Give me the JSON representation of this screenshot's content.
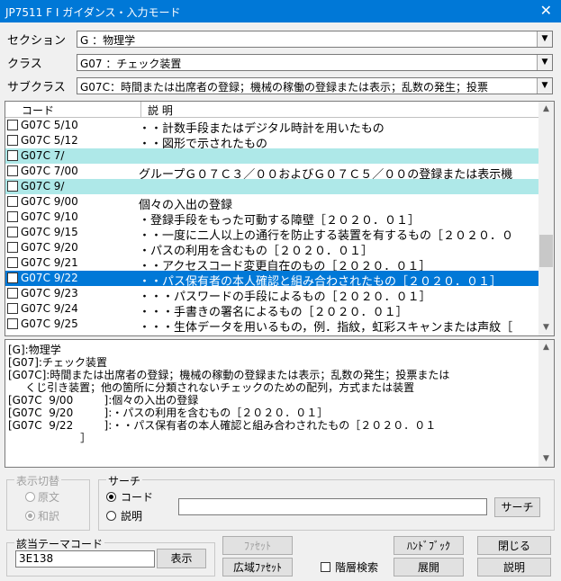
{
  "window": {
    "title": "JP7511  F I ガイダンス・入力モード",
    "close": "✕"
  },
  "section": {
    "label": "セクション",
    "value": "G    ：物理学"
  },
  "class": {
    "label": "クラス",
    "value": "G07  ：チェック装置"
  },
  "subclass": {
    "label": "サブクラス",
    "value": "G07C：時間または出席者の登録；機械の稼働の登録または表示；乱数の発生；投票"
  },
  "list": {
    "headers": {
      "code": "コード",
      "desc": "説 明"
    },
    "rows": [
      {
        "code": "G07C   5/10",
        "desc": "・・計数手段またはデジタル時計を用いたもの",
        "style": ""
      },
      {
        "code": "G07C   5/12",
        "desc": "・・図形で示されたもの",
        "style": ""
      },
      {
        "code": "G07C   7/",
        "desc": "",
        "style": "hl"
      },
      {
        "code": "G07C   7/00",
        "desc": "グループＧ０７Ｃ３／００およびＧ０７Ｃ５／００の登録または表示機",
        "style": ""
      },
      {
        "code": "G07C   9/",
        "desc": "",
        "style": "hl"
      },
      {
        "code": "G07C   9/00",
        "desc": "個々の入出の登録",
        "style": ""
      },
      {
        "code": "G07C   9/10",
        "desc": "・登録手段をもった可動する障壁［２０２０．０１］",
        "style": ""
      },
      {
        "code": "G07C   9/15",
        "desc": "・・一度に二人以上の通行を防止する装置を有するもの［２０２０．０",
        "style": ""
      },
      {
        "code": "G07C   9/20",
        "desc": "・パスの利用を含むもの［２０２０．０１］",
        "style": ""
      },
      {
        "code": "G07C   9/21",
        "desc": "・・アクセスコード変更自在のもの［２０２０．０１］",
        "style": ""
      },
      {
        "code": "G07C   9/22",
        "desc": "・・パス保有者の本人確認と組み合わされたもの［２０２０．０１］",
        "style": "sel"
      },
      {
        "code": "G07C   9/23",
        "desc": "・・・パスワードの手段によるもの［２０２０．０１］",
        "style": ""
      },
      {
        "code": "G07C   9/24",
        "desc": "・・・手書きの署名によるもの［２０２０．０１］",
        "style": ""
      },
      {
        "code": "G07C   9/25",
        "desc": "・・・生体データを用いるもの，例．指紋，虹彩スキャンまたは声紋［",
        "style": ""
      }
    ]
  },
  "detail": {
    "lines": [
      "[G]:物理学",
      "[G07]:チェック装置",
      "[G07C]:時間または出席者の登録；機械の稼動の登録または表示；乱数の発生；投票または",
      "     くじ引き装置；他の箇所に分類されないチェックのための配列，方式または装置",
      "[G07C  9/00         ]:個々の入出の登録",
      "[G07C  9/20         ]:・パスの利用を含むもの［２０２０．０１］",
      "[G07C  9/22         ]:・・パス保有者の本人確認と組み合わされたもの［２０２０．０１",
      "                     ］"
    ]
  },
  "display_toggle": {
    "caption": "表示切替",
    "original": "原文",
    "japanese": "和訳"
  },
  "search": {
    "caption": "サーチ",
    "code": "コード",
    "desc": "説明",
    "input": "",
    "button": "サーチ"
  },
  "theme": {
    "caption": "該当テーマコード",
    "value": "3E138",
    "show_button": "表示"
  },
  "buttons": {
    "facet": "ﾌｧｾｯﾄ",
    "wide_facet": "広域ﾌｧｾｯﾄ",
    "hierarchy_search": "階層検索",
    "handbook": "ﾊﾝﾄﾞﾌﾞｯｸ",
    "expand": "展開",
    "close": "閉じる",
    "explain": "説明"
  }
}
